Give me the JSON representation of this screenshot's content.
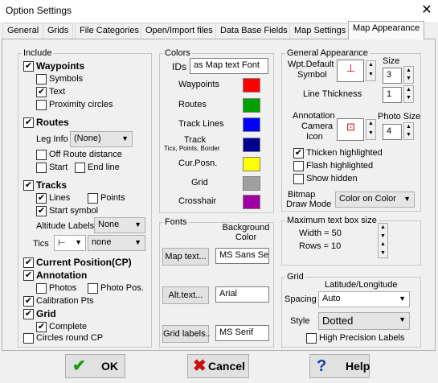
{
  "window": {
    "title": "Option Settings",
    "close": "✕"
  },
  "tabs": [
    "General",
    "Grids",
    "File Categories",
    "Open/Import files",
    "Data Base Fields",
    "Map Settings",
    "Map Appearance"
  ],
  "include": {
    "legend": "Include",
    "waypoints": "Waypoints",
    "symbols": "Symbols",
    "text": "Text",
    "proximity": "Proximity circles",
    "routes": "Routes",
    "leg_info": "Leg Info",
    "leg_info_value": "(None)",
    "off_route": "Off Route distance",
    "start": "Start",
    "end_line": "End line",
    "tracks": "Tracks",
    "lines": "Lines",
    "points": "Points",
    "start_symbol": "Start symbol",
    "altitude_labels": "Altitude Labels",
    "altitude_value": "None",
    "tics": "Tics",
    "tics_symbol": "⊢",
    "tics_value": "none",
    "current_position": "Current Position(CP)",
    "annotation": "Annotation",
    "photos": "Photos",
    "photo_pos": "Photo Pos.",
    "calibration": "Calibration Pts",
    "grid": "Grid",
    "complete": "Complete",
    "circles": "Circles round CP"
  },
  "colors": {
    "legend": "Colors",
    "ids": "IDs",
    "ids_value": "as Map text Font",
    "items": [
      {
        "label": "Waypoints",
        "color": "#ff0000"
      },
      {
        "label": "Routes",
        "color": "#00a000"
      },
      {
        "label": "Track Lines",
        "color": "#0000ff"
      },
      {
        "label": "Track",
        "sub": "Tics, Points, Border",
        "color": "#000090"
      },
      {
        "label": "Cur.Posn.",
        "color": "#ffff00"
      },
      {
        "label": "Grid",
        "color": "#a0a0a0"
      },
      {
        "label": "Crosshair",
        "color": "#a000a0"
      }
    ]
  },
  "fonts": {
    "legend": "Fonts",
    "bg_label": "Background Color",
    "map_text": "Map text...",
    "map_text_font": "MS Sans Serif",
    "alt_text": "Alt.text...",
    "alt_text_font": "Arial",
    "grid_labels": "Grid labels..",
    "grid_labels_font": "MS Serif"
  },
  "appearance": {
    "legend": "General Appearance",
    "wpt_default": "Wpt.Default",
    "symbol": "Symbol",
    "size": "Size",
    "size_value": "3",
    "line_thickness": "Line Thickness",
    "line_value": "1",
    "annotation": "Annotation",
    "camera": "Camera",
    "icon": "Icon",
    "photo_size": "Photo Size",
    "photo_value": "4",
    "thicken": "Thicken highlighted",
    "flash": "Flash highlighted",
    "show_hidden": "Show hidden",
    "bitmap": "Bitmap",
    "draw_mode": "Draw Mode",
    "draw_mode_value": "Color on Color"
  },
  "maxtext": {
    "legend": "Maximum text box size",
    "width": "Width = 50",
    "rows": "Rows  = 10"
  },
  "gridbox": {
    "legend": "Grid",
    "header": "Latitude/Longitude",
    "spacing": "Spacing",
    "spacing_value": "Auto",
    "style": "Style",
    "style_value": "Dotted",
    "high_precision": "High Precision Labels"
  },
  "buttons": {
    "ok": "OK",
    "cancel": "Cancel",
    "help": "Help"
  }
}
